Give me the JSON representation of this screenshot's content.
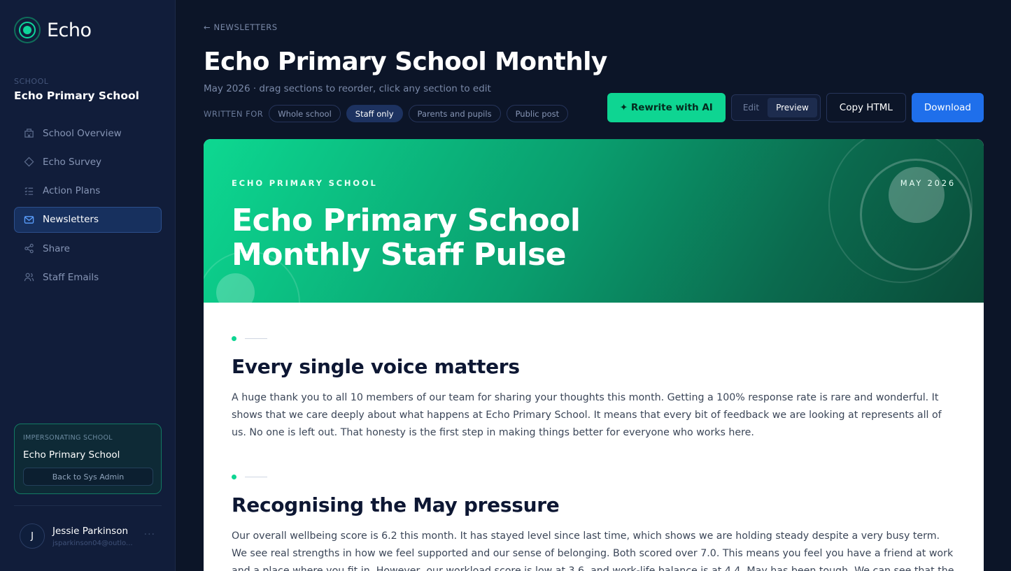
{
  "app": {
    "name": "Echo"
  },
  "sidebar": {
    "school_caption": "SCHOOL",
    "school_name": "Echo Primary School",
    "items": [
      {
        "label": "School Overview",
        "icon": "building-icon"
      },
      {
        "label": "Echo Survey",
        "icon": "diamond-icon"
      },
      {
        "label": "Action Plans",
        "icon": "checklist-icon"
      },
      {
        "label": "Newsletters",
        "icon": "mail-icon",
        "active": true
      },
      {
        "label": "Share",
        "icon": "share-icon"
      },
      {
        "label": "Staff Emails",
        "icon": "users-icon"
      }
    ],
    "impersonating": {
      "caption": "IMPERSONATING SCHOOL",
      "school": "Echo Primary School",
      "back_label": "Back to Sys Admin"
    },
    "user": {
      "initial": "J",
      "name": "Jessie Parkinson",
      "email": "jsparkinson04@outlo...",
      "more": "···"
    }
  },
  "header": {
    "back_label": "← NEWSLETTERS",
    "title": "Echo Primary School Monthly",
    "subtitle": "May 2026 · drag sections to reorder, click any section to edit",
    "audience_label": "WRITTEN FOR",
    "audiences": [
      "Whole school",
      "Staff only",
      "Parents and pupils",
      "Public post"
    ],
    "audience_selected": "Staff only"
  },
  "toolbar": {
    "ai_label": "✦ Rewrite with AI",
    "mode_edit": "Edit",
    "mode_preview": "Preview",
    "mode_selected": "Preview",
    "copy_label": "Copy HTML",
    "download_label": "Download"
  },
  "newsletter": {
    "hero_caption": "ECHO PRIMARY SCHOOL",
    "hero_date": "MAY 2026",
    "hero_title": "Echo Primary School Monthly Staff Pulse",
    "sections": [
      {
        "title": "Every single voice matters",
        "body": "A huge thank you to all 10 members of our team for sharing your thoughts this month. Getting a 100% response rate is rare and wonderful. It shows that we care deeply about what happens at Echo Primary School. It means that every bit of feedback we are looking at represents all of us. No one is left out. That honesty is the first step in making things better for everyone who works here."
      },
      {
        "title": "Recognising the May pressure",
        "body": "Our overall wellbeing score is 6.2 this month. It has stayed level since last time, which shows we are holding steady despite a very busy term. We see real strengths in how we feel supported and our sense of belonging. Both scored over 7.0. This means you feel you have a friend at work and a place where you fit in. However, our workload score is low at 3.6, and work-life balance is at 4.4. May has been tough. We can see that the weight of tasks has"
      }
    ]
  },
  "colors": {
    "accent_green": "#0ed592",
    "primary_blue": "#1f6feb",
    "sidebar_bg": "#111d3a",
    "page_bg": "#0c1528"
  }
}
